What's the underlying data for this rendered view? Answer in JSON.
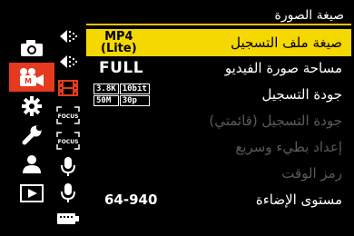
{
  "header": {
    "title": "صيغة الصورة"
  },
  "accent_colors": {
    "selected_row": "#f5d800",
    "active_tab": "#e53a1e",
    "header_rule": "#f0c300"
  },
  "main_tabs": [
    {
      "icon": "camera-icon",
      "active": false
    },
    {
      "icon": "video-camera-icon",
      "active": true
    },
    {
      "icon": "gear-icon",
      "active": false
    },
    {
      "icon": "wrench-icon",
      "active": false
    },
    {
      "icon": "person-icon",
      "active": false
    },
    {
      "icon": "playback-icon",
      "active": false
    }
  ],
  "sub_tabs": [
    {
      "icon": "exposure-arrows-icon",
      "active": false
    },
    {
      "icon": "exposure-arrows-icon",
      "active": false
    },
    {
      "icon": "film-strip-icon",
      "active": true
    },
    {
      "icon": "focus-icon",
      "label": "FOCUS",
      "active": false
    },
    {
      "icon": "focus-icon",
      "label": "FOCUS",
      "active": false
    },
    {
      "icon": "microphone-icon",
      "active": false
    },
    {
      "icon": "microphone-icon",
      "active": false
    },
    {
      "icon": "hdmi-icon",
      "active": false
    }
  ],
  "menu": {
    "items": [
      {
        "label": "صيغة ملف التسجيل",
        "value_line1": "MP4",
        "value_line2": "(Lite)",
        "selected": true,
        "enabled": true
      },
      {
        "label": "مساحة صورة الفيديو",
        "value": "FULL",
        "selected": false,
        "enabled": true
      },
      {
        "label": "جودة التسجيل",
        "quality": {
          "res": "3.8K",
          "bit": "10bit",
          "rate": "50M",
          "fps": "30p"
        },
        "selected": false,
        "enabled": true
      },
      {
        "label": "جودة التسجيل (قائمتي)",
        "selected": false,
        "enabled": false
      },
      {
        "label": "إعداد بطيء وسريع",
        "selected": false,
        "enabled": false
      },
      {
        "label": "رمز الوقت",
        "selected": false,
        "enabled": false
      },
      {
        "label": "مستوى الإضاءة",
        "value": "64-940",
        "selected": false,
        "enabled": true
      }
    ]
  }
}
